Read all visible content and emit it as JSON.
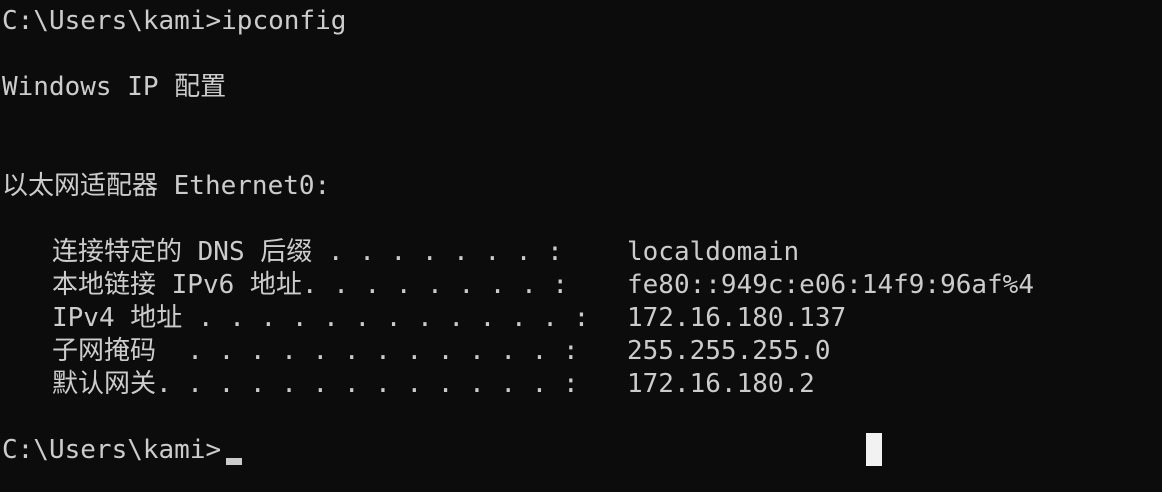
{
  "console": {
    "command_line": "C:\\Users\\kami>ipconfig",
    "header": "Windows IP 配置",
    "adapter": "以太网适配器 Ethernet0:",
    "rows": [
      {
        "label": "连接特定的 DNS 后缀 . . . . . . . :",
        "value": "localdomain"
      },
      {
        "label": "本地链接 IPv6 地址. . . . . . . . :",
        "value": "fe80::949c:e06:14f9:96af%4"
      },
      {
        "label": "IPv4 地址 . . . . . . . . . . . . :",
        "value": "172.16.180.137"
      },
      {
        "label": "子网掩码  . . . . . . . . . . . . :",
        "value": "255.255.255.0"
      },
      {
        "label": "默认网关. . . . . . . . . . . . . :",
        "value": "172.16.180.2"
      }
    ],
    "prompt": "C:\\Users\\kami>"
  },
  "colors": {
    "background": "#0c0c0c",
    "foreground": "#cccccc",
    "cursor_block": "#f2f2f2"
  }
}
